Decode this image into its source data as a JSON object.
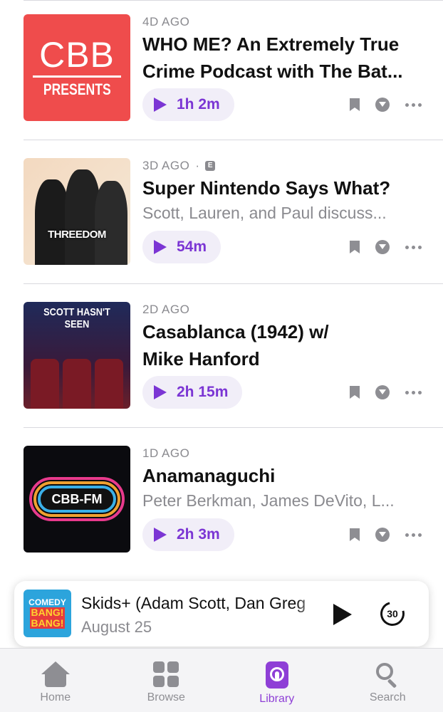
{
  "episodes": [
    {
      "age": "4D AGO",
      "explicit": false,
      "title_line1": "WHO ME? An Extremely True",
      "title_line2": "Crime Podcast with The Bat...",
      "description": "",
      "duration": "1h 2m",
      "artwork": {
        "kind": "cbb-presents",
        "big": "CBB",
        "small": "PRESENTS"
      }
    },
    {
      "age": "3D AGO",
      "explicit": true,
      "explicit_badge": "E",
      "title_line1": "Super Nintendo Says What?",
      "title_line2": "",
      "description": "Scott, Lauren, and Paul discuss...",
      "duration": "54m",
      "artwork": {
        "kind": "threedom",
        "word": "THREEDOM"
      }
    },
    {
      "age": "2D AGO",
      "explicit": false,
      "title_line1": "Casablanca (1942) w/",
      "title_line2": "Mike Hanford",
      "description": "",
      "duration": "2h 15m",
      "artwork": {
        "kind": "scott-hasnt-seen",
        "header": "SCOTT HASN'T SEEN"
      }
    },
    {
      "age": "1D AGO",
      "explicit": false,
      "title_line1": "Anamanaguchi",
      "title_line2": "",
      "description": "Peter Berkman, James DeVito, L...",
      "duration": "2h 3m",
      "artwork": {
        "kind": "cbb-fm",
        "word": "CBB-FM"
      }
    }
  ],
  "mini_player": {
    "title": "Skids+ (Adam Scott, Dan Greg",
    "date": "August 25",
    "skip_seconds": "30",
    "artwork": {
      "line1": "COMEDY",
      "line2": "BANG!",
      "line3": "BANG!"
    }
  },
  "tabs": [
    {
      "label": "Home",
      "icon": "home-icon",
      "active": false
    },
    {
      "label": "Browse",
      "icon": "browse-grid-icon",
      "active": false
    },
    {
      "label": "Library",
      "icon": "library-icon",
      "active": true
    },
    {
      "label": "Search",
      "icon": "search-icon",
      "active": false
    }
  ],
  "colors": {
    "accent": "#8e3fd6",
    "play_purple": "#7b35d4",
    "secondary_text": "#8a8a8f"
  }
}
